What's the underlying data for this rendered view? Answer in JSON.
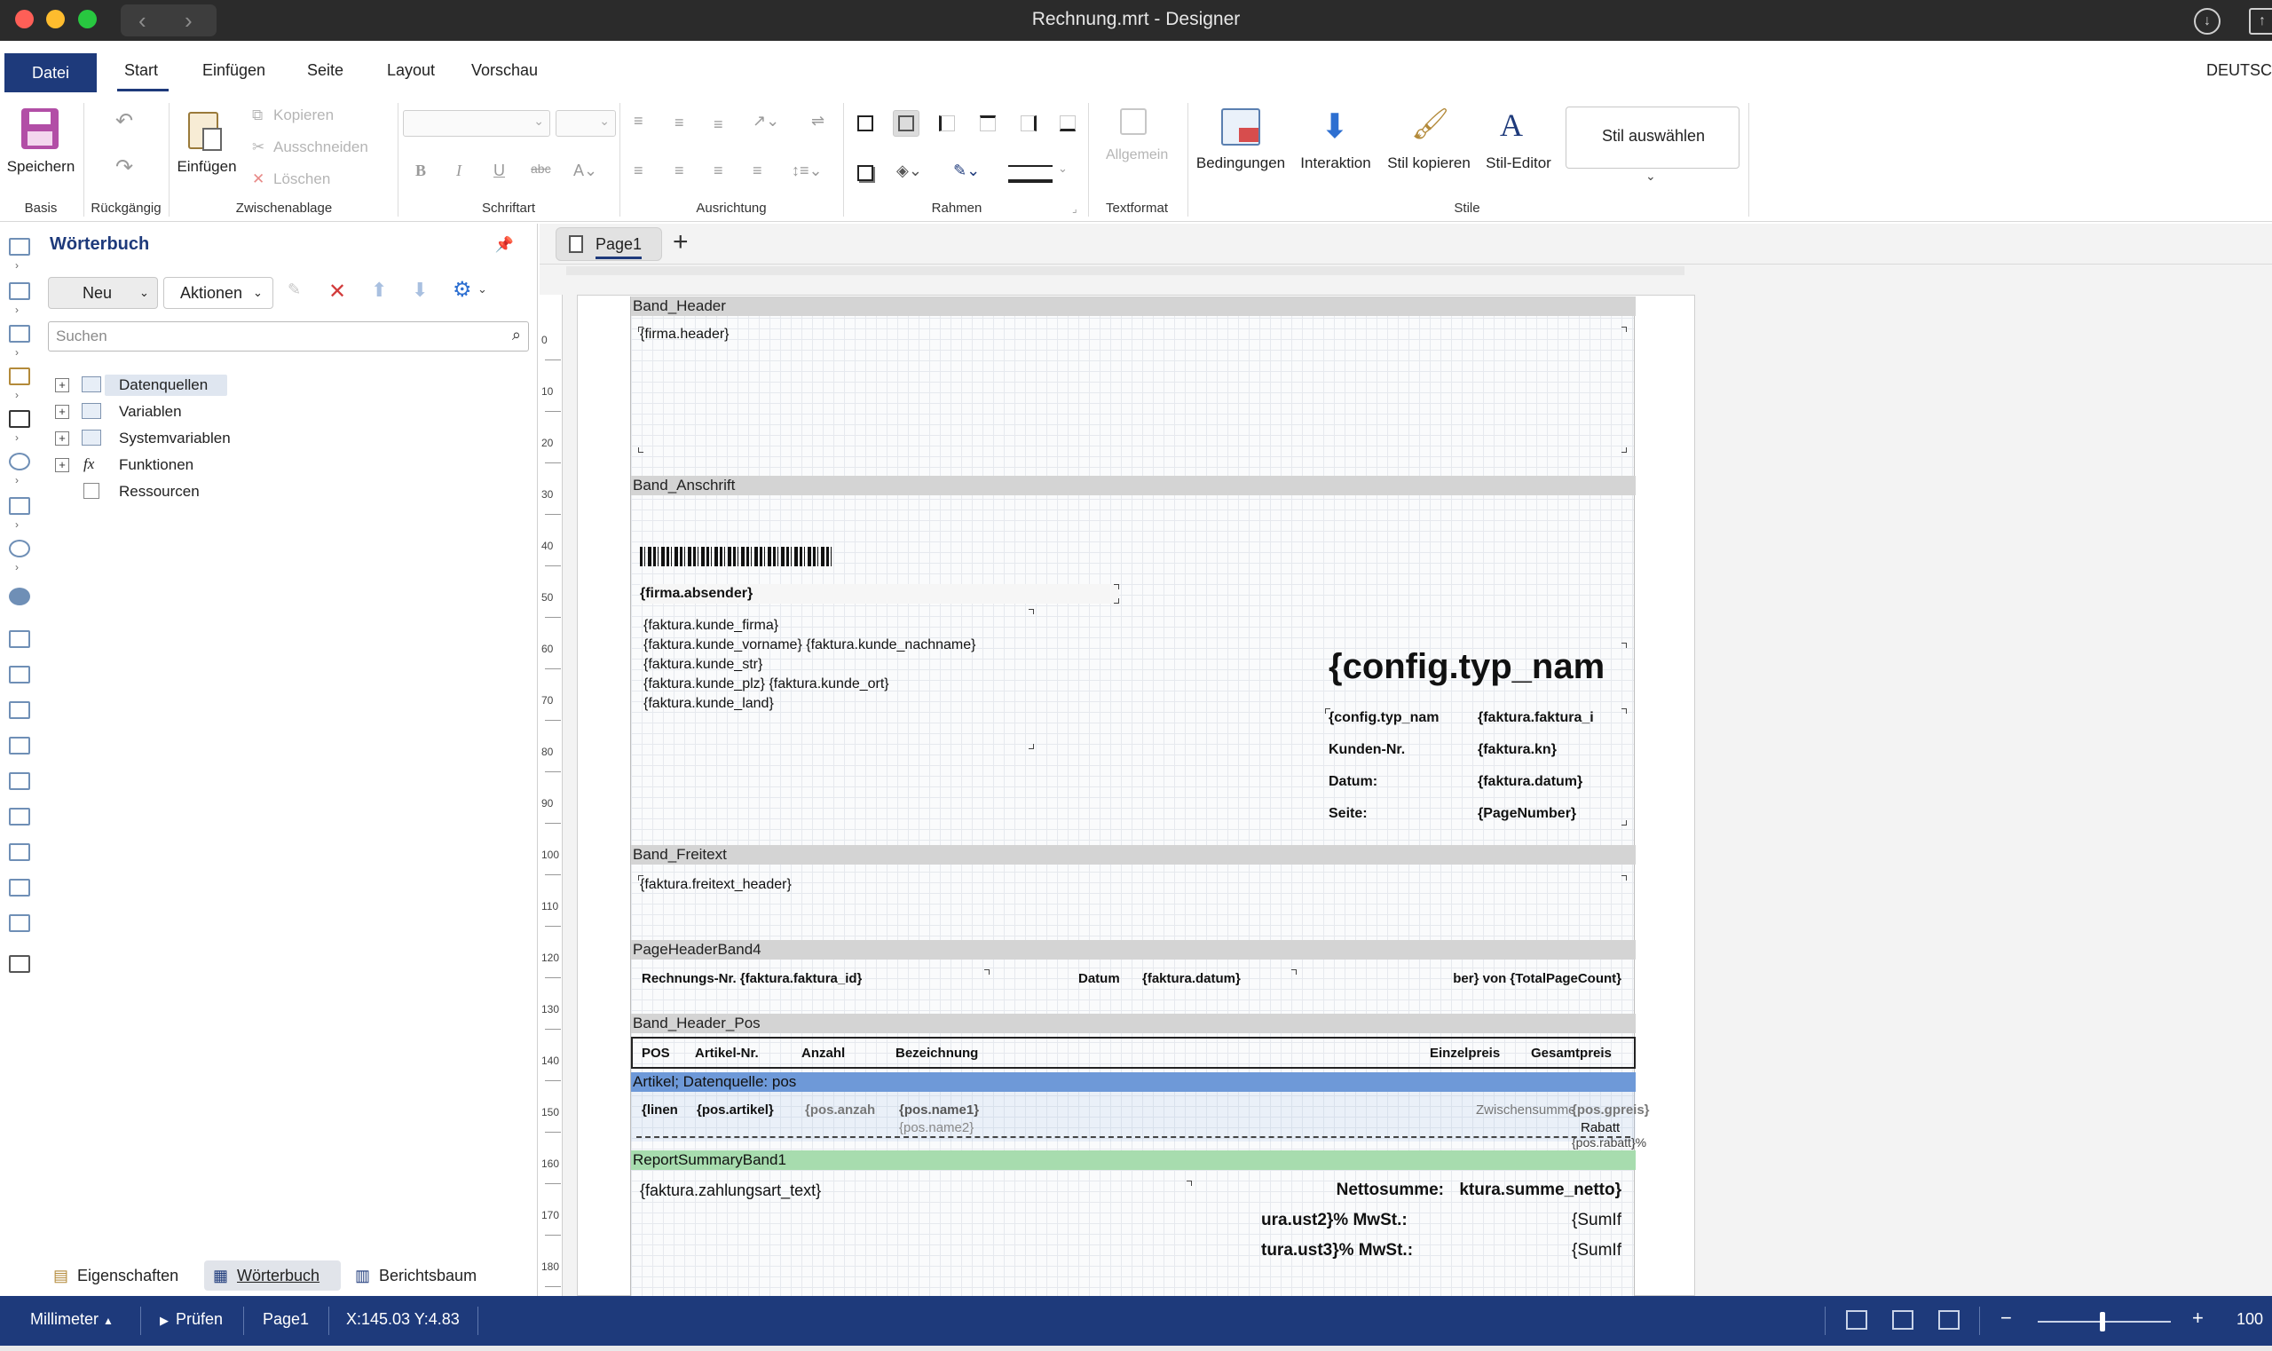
{
  "window": {
    "title": "Rechnung.mrt - Designer"
  },
  "ribbon_tabs": [
    "Datei",
    "Start",
    "Einfügen",
    "Seite",
    "Layout",
    "Vorschau"
  ],
  "language": "DEUTSC",
  "ribbon": {
    "basis": {
      "save": "Speichern",
      "group": "Basis"
    },
    "undo": {
      "group": "Rückgängig"
    },
    "clipboard": {
      "paste": "Einfügen",
      "copy": "Kopieren",
      "cut": "Ausschneiden",
      "delete": "Löschen",
      "group": "Zwischenablage"
    },
    "font": {
      "group": "Schriftart"
    },
    "align": {
      "group": "Ausrichtung"
    },
    "borders": {
      "group": "Rahmen"
    },
    "textformat": {
      "general": "Allgemein",
      "group": "Textformat"
    },
    "styles": {
      "conditions": "Bedingungen",
      "interaction": "Interaktion",
      "copy_style": "Stil kopieren",
      "style_editor": "Stil-Editor",
      "choose_style": "Stil auswählen",
      "group": "Stile"
    }
  },
  "dictionary": {
    "title": "Wörterbuch",
    "new_button": "Neu",
    "actions_button": "Aktionen",
    "search_placeholder": "Suchen",
    "tree": [
      "Datenquellen",
      "Variablen",
      "Systemvariablen",
      "Funktionen",
      "Ressourcen"
    ],
    "function_icon": "fx"
  },
  "panel_tabs": [
    "Eigenschaften",
    "Wörterbuch",
    "Berichtsbaum"
  ],
  "page_tab": "Page1",
  "ruler_labels": [
    "0",
    "10",
    "20",
    "30",
    "40",
    "50",
    "60",
    "70",
    "80",
    "90",
    "100",
    "110",
    "120",
    "130",
    "140",
    "150",
    "160",
    "170",
    "180"
  ],
  "report": {
    "band_header": {
      "name": "Band_Header",
      "firma_header": "{firma.header}"
    },
    "band_anschrift": {
      "name": "Band_Anschrift",
      "absender": "{firma.absender}",
      "address_lines": [
        "{faktura.kunde_firma}",
        "{faktura.kunde_vorname} {faktura.kunde_nachname}",
        "{faktura.kunde_str}",
        "{faktura.kunde_plz} {faktura.kunde_ort}",
        "{faktura.kunde_land}"
      ],
      "config_title": "{config.typ_nam",
      "config_typ": "{config.typ_nam",
      "faktura_id": "{faktura.faktura_i",
      "kunden_nr_label": "Kunden-Nr.",
      "kunden_nr": "{faktura.kn}",
      "datum_label": "Datum:",
      "datum": "{faktura.datum}",
      "seite_label": "Seite:",
      "page_number": "{PageNumber}"
    },
    "band_freitext": {
      "name": "Band_Freitext",
      "text": "{faktura.freitext_header}"
    },
    "page_header": {
      "name": "PageHeaderBand4",
      "rechnungs_nr": "Rechnungs-Nr. {faktura.faktura_id}",
      "datum_label": "Datum",
      "datum": "{faktura.datum}",
      "total": "ber} von {TotalPageCount}"
    },
    "band_header_pos": {
      "name": "Band_Header_Pos",
      "cols": [
        "POS",
        "Artikel-Nr.",
        "Anzahl",
        "Bezeichnung",
        "Einzelpreis",
        "Gesamtpreis"
      ]
    },
    "artikel": {
      "name": "Artikel; Datenquelle: pos",
      "linenr": "{linen",
      "artikel": "{pos.artikel}",
      "anzahl": "{pos.anzah",
      "name1": "{pos.name1}",
      "name2": "{pos.name2}",
      "zwischensumme": "Zwischensumme",
      "gpreis": "{pos.gpreis}",
      "rabatt": "Rabatt",
      "rabatt_val": "{pos.rabatt}%"
    },
    "summary": {
      "name": "ReportSummaryBand1",
      "zahlungsart": "{faktura.zahlungsart_text}",
      "netto_label": "Nettosumme:",
      "netto": "ktura.summe_netto}",
      "ust2": "ura.ust2}% MwSt.:",
      "ust3": "tura.ust3}% MwSt.:",
      "sum1": "{SumIf",
      "sum2": "{SumIf"
    }
  },
  "status": {
    "unit": "Millimeter",
    "check": "Prüfen",
    "page": "Page1",
    "coords": "X:145.03 Y:4.83",
    "zoom": "100"
  }
}
